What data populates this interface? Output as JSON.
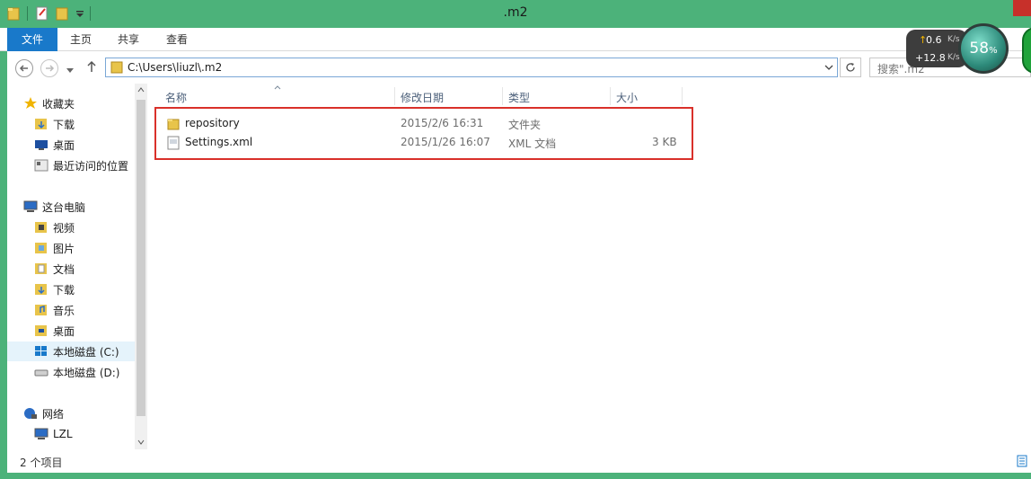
{
  "window": {
    "title": ".m2"
  },
  "ribbon": {
    "tabs": [
      "文件",
      "主页",
      "共享",
      "查看"
    ]
  },
  "address": {
    "path": "C:\\Users\\liuzl\\.m2",
    "search_placeholder": "搜索\".m2"
  },
  "nav": {
    "favorites": {
      "label": "收藏夹",
      "items": [
        "下载",
        "桌面",
        "最近访问的位置"
      ]
    },
    "computer": {
      "label": "这台电脑",
      "items": [
        "视频",
        "图片",
        "文档",
        "下载",
        "音乐",
        "桌面",
        "本地磁盘 (C:)",
        "本地磁盘 (D:)"
      ]
    },
    "network": {
      "label": "网络",
      "items": [
        "LZL"
      ]
    }
  },
  "columns": [
    "名称",
    "修改日期",
    "类型",
    "大小"
  ],
  "files": [
    {
      "name": "repository",
      "date": "2015/2/6 16:31",
      "type": "文件夹",
      "size": ""
    },
    {
      "name": "Settings.xml",
      "date": "2015/1/26 16:07",
      "type": "XML 文档",
      "size": "3 KB"
    }
  ],
  "status": {
    "count": "2 个项目"
  },
  "widget": {
    "up": "0.6",
    "up_unit": "K/s",
    "down": "+12.8",
    "down_unit": "K/s",
    "percent": "58",
    "percent_sign": "%"
  },
  "colors": {
    "accent": "#1979ca",
    "frame": "#4cb27a",
    "highlight": "#d9302a"
  }
}
